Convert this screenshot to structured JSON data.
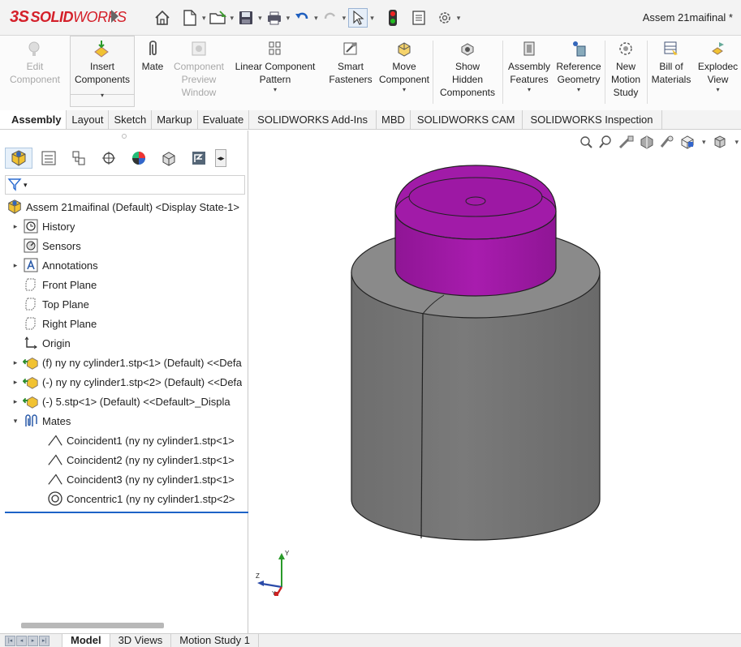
{
  "app": {
    "logo_ds": "3S",
    "logo_solid": "SOLID",
    "logo_works": "WORKS",
    "document_title": "Assem 21maifinal *"
  },
  "ribbon": [
    {
      "id": "edit-component",
      "line1": "Edit",
      "line2": "Component",
      "line3": "",
      "disabled": true
    },
    {
      "id": "insert-components",
      "line1": "Insert",
      "line2": "Components",
      "line3": "",
      "disabled": false
    },
    {
      "id": "mate",
      "line1": "Mate",
      "line2": "",
      "line3": "",
      "disabled": false
    },
    {
      "id": "component-preview-window",
      "line1": "Component",
      "line2": "Preview",
      "line3": "Window",
      "disabled": true
    },
    {
      "id": "linear-component-pattern",
      "line1": "Linear Component",
      "line2": "Pattern",
      "line3": "",
      "disabled": false
    },
    {
      "id": "smart-fasteners",
      "line1": "Smart",
      "line2": "Fasteners",
      "line3": "",
      "disabled": false
    },
    {
      "id": "move-component",
      "line1": "Move",
      "line2": "Component",
      "line3": "",
      "disabled": false
    },
    {
      "id": "show-hidden-components",
      "line1": "Show",
      "line2": "Hidden",
      "line3": "Components",
      "disabled": false
    },
    {
      "id": "assembly-features",
      "line1": "Assembly",
      "line2": "Features",
      "line3": "",
      "disabled": false
    },
    {
      "id": "reference-geometry",
      "line1": "Reference",
      "line2": "Geometry",
      "line3": "",
      "disabled": false
    },
    {
      "id": "new-motion-study",
      "line1": "New",
      "line2": "Motion",
      "line3": "Study",
      "disabled": false
    },
    {
      "id": "bill-of-materials",
      "line1": "Bill of",
      "line2": "Materials",
      "line3": "",
      "disabled": false
    },
    {
      "id": "exploded-view",
      "line1": "Explodec",
      "line2": "View",
      "line3": "",
      "disabled": false
    }
  ],
  "tabs": [
    "Assembly",
    "Layout",
    "Sketch",
    "Markup",
    "Evaluate",
    "SOLIDWORKS Add-Ins",
    "MBD",
    "SOLIDWORKS CAM",
    "SOLIDWORKS Inspection"
  ],
  "tree": {
    "root": "Assem 21maifinal (Default) <Display State-1>",
    "items": [
      {
        "label": "History",
        "icon": "history-icon"
      },
      {
        "label": "Sensors",
        "icon": "sensors-icon"
      },
      {
        "label": "Annotations",
        "icon": "annotations-icon"
      },
      {
        "label": "Front Plane",
        "icon": "plane-icon"
      },
      {
        "label": "Top Plane",
        "icon": "plane-icon"
      },
      {
        "label": "Right Plane",
        "icon": "plane-icon"
      },
      {
        "label": "Origin",
        "icon": "origin-icon"
      },
      {
        "label": "(f) ny ny cylinder1.stp<1> (Default) <<Defa",
        "icon": "part-icon"
      },
      {
        "label": "(-) ny ny cylinder1.stp<2> (Default) <<Defa",
        "icon": "part-icon"
      },
      {
        "label": "(-) 5.stp<1> (Default) <<Default>_Displa",
        "icon": "part-icon"
      },
      {
        "label": "Mates",
        "icon": "mates-icon"
      },
      {
        "label": "Coincident1 (ny ny cylinder1.stp<1>",
        "icon": "coincident-icon"
      },
      {
        "label": "Coincident2 (ny ny cylinder1.stp<1>",
        "icon": "coincident-icon"
      },
      {
        "label": "Coincident3 (ny ny cylinder1.stp<1>",
        "icon": "coincident-icon"
      },
      {
        "label": "Concentric1 (ny ny cylinder1.stp<2>",
        "icon": "concentric-icon"
      }
    ]
  },
  "triad": {
    "x": "Y",
    "y": "Z",
    "z": "Y"
  },
  "bottom_tabs": [
    "Model",
    "3D Views",
    "Motion Study 1"
  ],
  "colors": {
    "accent": "#1d63c7",
    "cap": "#a21aa8",
    "body": "#777777",
    "brand": "#d4202a"
  }
}
